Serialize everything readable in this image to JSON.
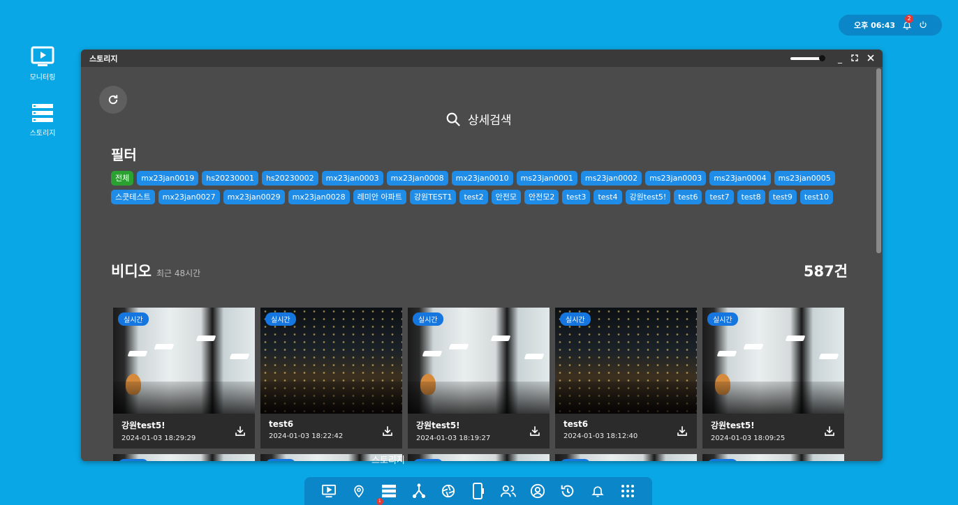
{
  "status": {
    "time": "오후 06:43",
    "notification_count": "2"
  },
  "desktop": [
    {
      "label": "모니터링",
      "icon": "monitor-play-icon"
    },
    {
      "label": "스토리지",
      "icon": "storage-list-icon"
    }
  ],
  "window": {
    "title": "스토리지"
  },
  "search": {
    "label": "상세검색"
  },
  "filter": {
    "title": "필터",
    "chips": [
      "전체",
      "mx23jan0019",
      "hs20230001",
      "hs20230002",
      "mx23jan0003",
      "mx23jan0008",
      "mx23jan0010",
      "ms23jan0001",
      "ms23jan0002",
      "ms23jan0003",
      "ms23jan0004",
      "ms23jan0005",
      "스쿳테스트",
      "mx23jan0027",
      "mx23jan0029",
      "mx23jan0028",
      "레미안 아파트",
      "강원TEST1",
      "test2",
      "안전모",
      "안전모2",
      "test3",
      "test4",
      "강원test5!",
      "test6",
      "test7",
      "test8",
      "test9",
      "test10"
    ],
    "active_index": 0
  },
  "video": {
    "title": "비디오",
    "subtitle": "최근 48시간",
    "count": "587건",
    "live_label": "실시간",
    "cards": [
      {
        "name": "강원test5!",
        "date": "2024-01-03 18:29:29",
        "scene": "office"
      },
      {
        "name": "test6",
        "date": "2024-01-03 18:22:42",
        "scene": "night"
      },
      {
        "name": "강원test5!",
        "date": "2024-01-03 18:19:27",
        "scene": "office"
      },
      {
        "name": "test6",
        "date": "2024-01-03 18:12:40",
        "scene": "night"
      },
      {
        "name": "강원test5!",
        "date": "2024-01-03 18:09:25",
        "scene": "office"
      }
    ]
  },
  "tooltip": "스토리지",
  "dock": {
    "items": [
      "monitor-play-icon",
      "location-pin-icon",
      "storage-list-icon",
      "network-icon",
      "aperture-icon",
      "mobile-device-icon",
      "users-icon",
      "account-icon",
      "history-icon",
      "bell-icon",
      "apps-grid-icon"
    ],
    "storage_badge": "1"
  },
  "colors": {
    "desktop_bg": "#0aa7e6",
    "window_bg": "#4b4b4b",
    "chip": "#1f8ce8",
    "chip_active": "#2aa131",
    "live_badge": "#1676e0"
  }
}
